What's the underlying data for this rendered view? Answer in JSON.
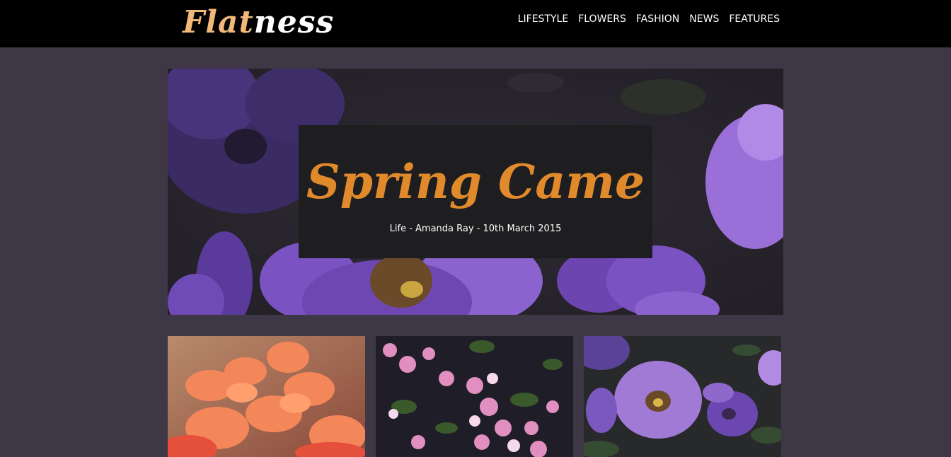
{
  "header": {
    "logo_part1": "Flat",
    "logo_part2": "ness",
    "nav": [
      "LIFESTYLE",
      "FLOWERS",
      "FASHION",
      "NEWS",
      "FEATURES"
    ]
  },
  "hero": {
    "title": "Spring Came",
    "meta": "Life - Amanda Ray - 10th March 2015"
  },
  "colors": {
    "page_bg": "#3e3745",
    "header_bg": "#000000",
    "accent_orange": "#e08a2c",
    "logo_orange": "#f2b87a"
  }
}
